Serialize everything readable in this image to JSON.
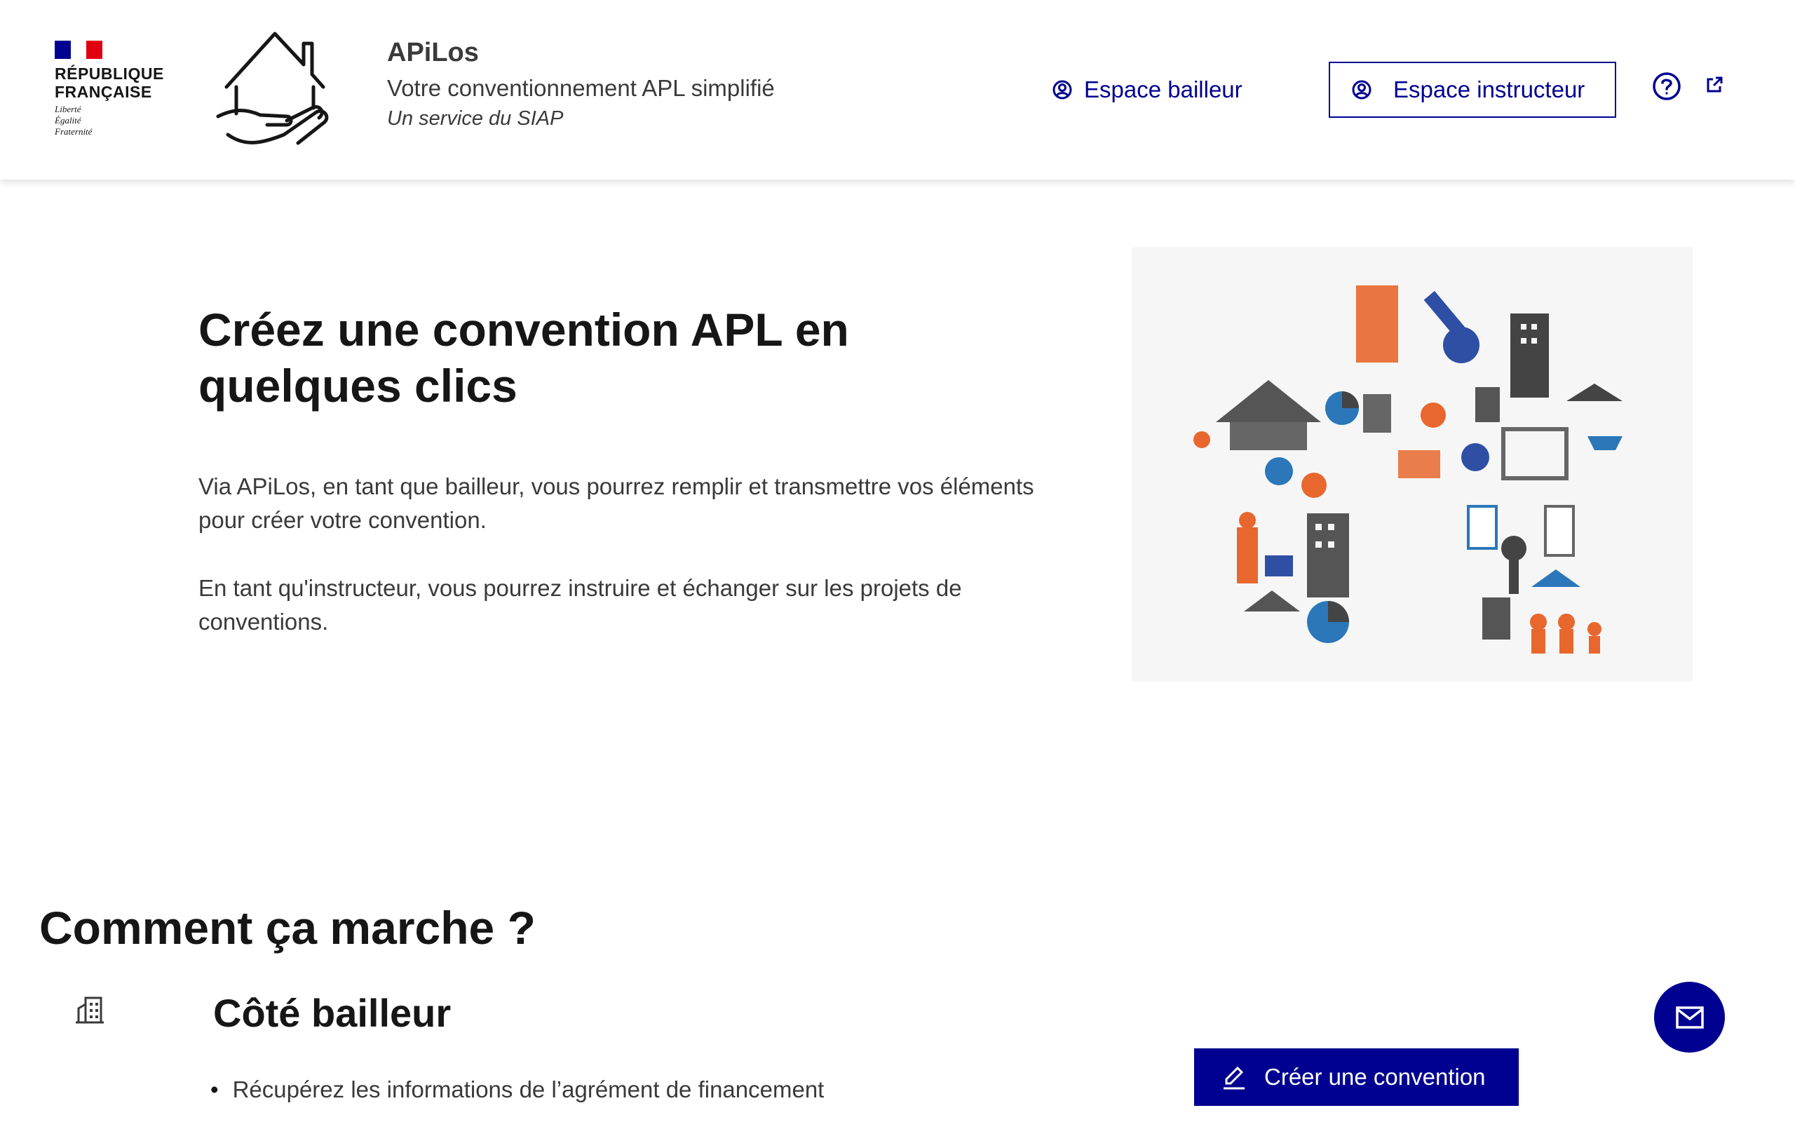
{
  "header": {
    "marianne_text": [
      "RÉPUBLIQUE",
      "FRANÇAISE"
    ],
    "devise": [
      "Liberté",
      "Égalité",
      "Fraternité"
    ],
    "brand_title": "APiLos",
    "brand_tagline": "Votre conventionnement APL simplifié",
    "brand_subtitle": "Un service du SIAP",
    "nav_bailleur_label": "Espace bailleur",
    "nav_instructeur_label": "Espace instructeur",
    "help_icon": "question-circle-icon",
    "external_icon": "external-link-icon"
  },
  "hero": {
    "title": "Créez une convention APL en quelques clics",
    "paragraph1": "Via APiLos, en tant que bailleur, vous pourrez remplir et transmettre vos éléments pour créer votre convention.",
    "paragraph2": "En tant qu'instructeur, vous pourrez instruire et échanger sur les projets de conventions."
  },
  "how": {
    "title": "Comment ça marche ?",
    "side_title": "Côté bailleur",
    "steps": [
      "Récupérez les informations de l’agrément de financement"
    ],
    "create_button_label": "Créer une convention"
  },
  "colors": {
    "primary": "#000091",
    "flag_blue": "#000091",
    "flag_red": "#e1000f",
    "text": "#161616",
    "text_muted": "#3a3a3a"
  }
}
